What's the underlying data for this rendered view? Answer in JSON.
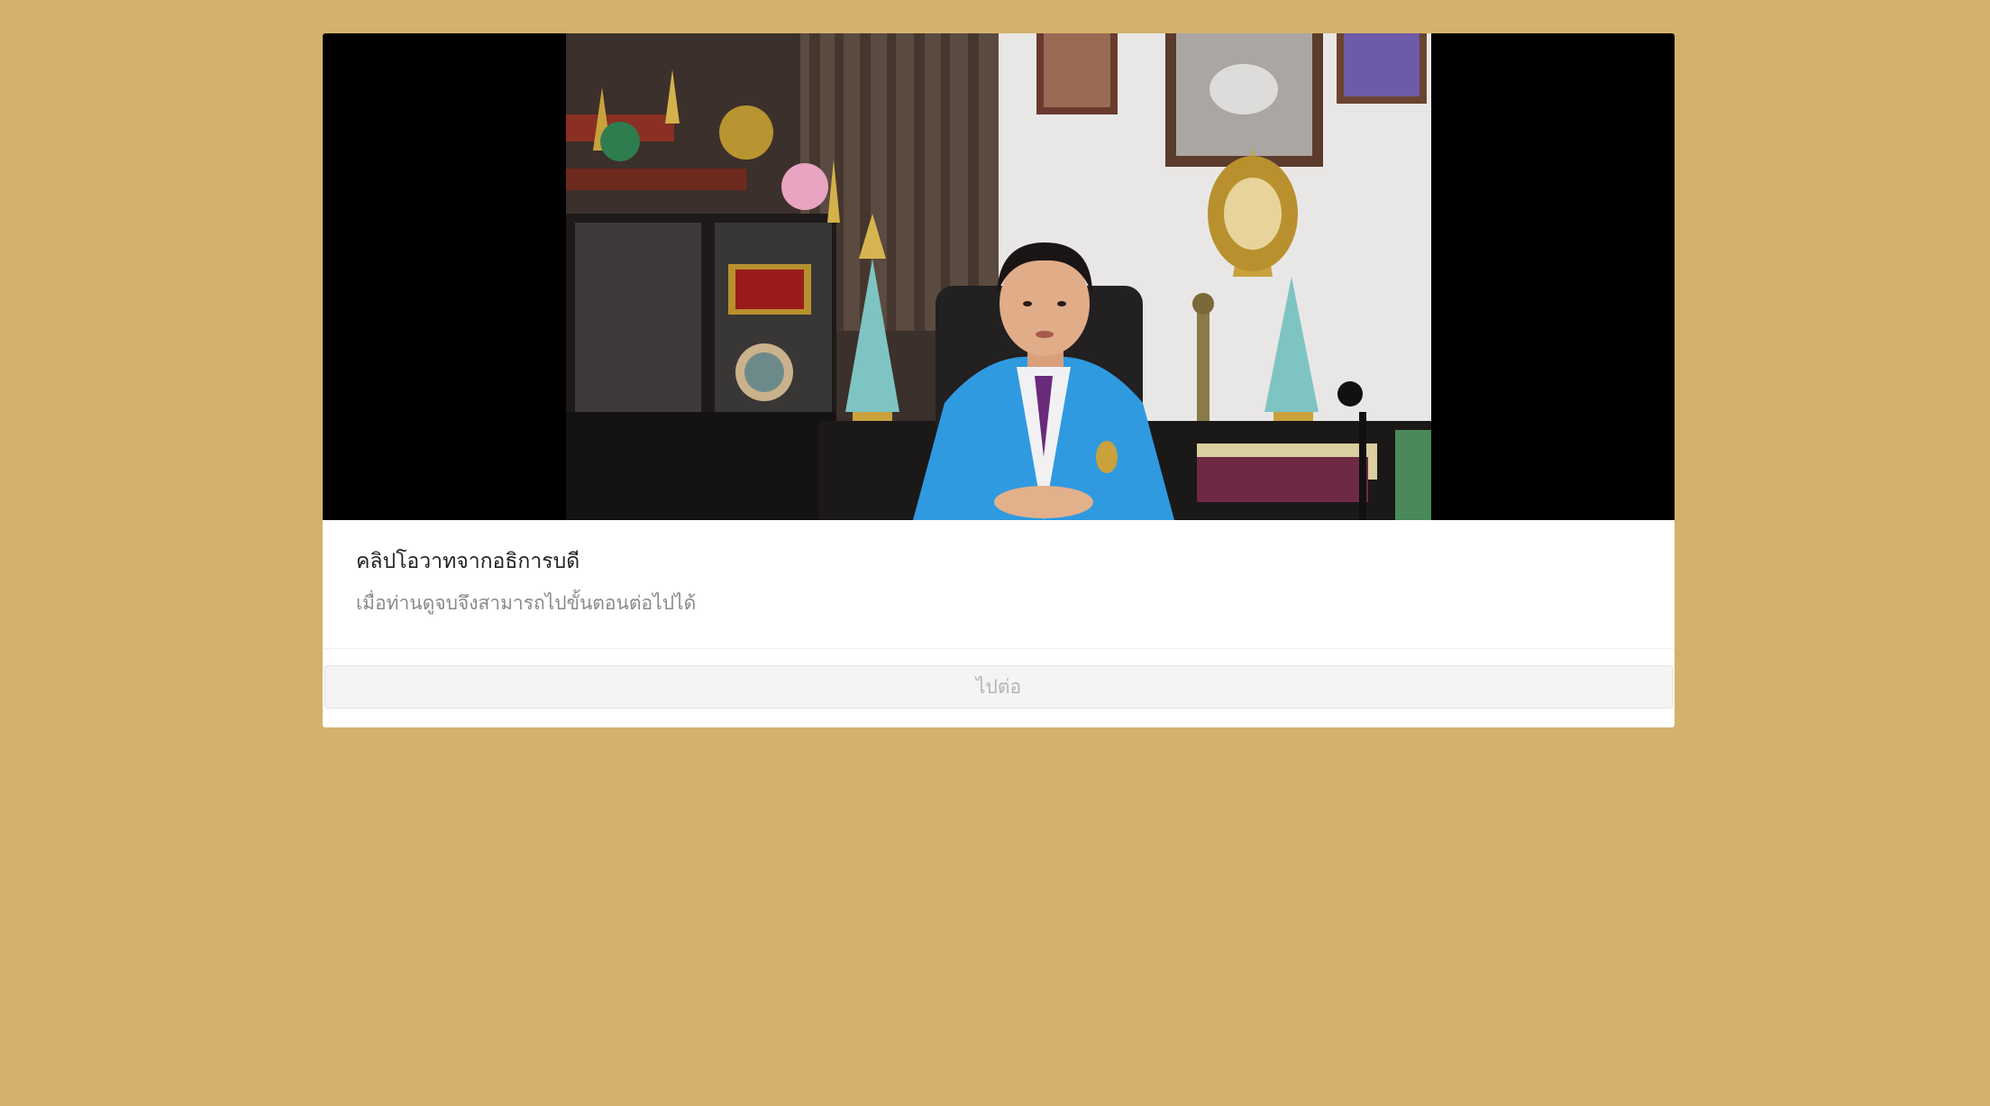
{
  "page": {
    "background_color": "#d4b16c"
  },
  "video": {
    "frame_description_hidden": false
  },
  "card": {
    "title": "คลิปโอวาทจากอธิการบดี",
    "subtitle": "เมื่อท่านดูจบจึงสามารถไปขั้นตอนต่อไปได้"
  },
  "footer": {
    "continue_label": "ไปต่อ",
    "continue_disabled": true
  }
}
